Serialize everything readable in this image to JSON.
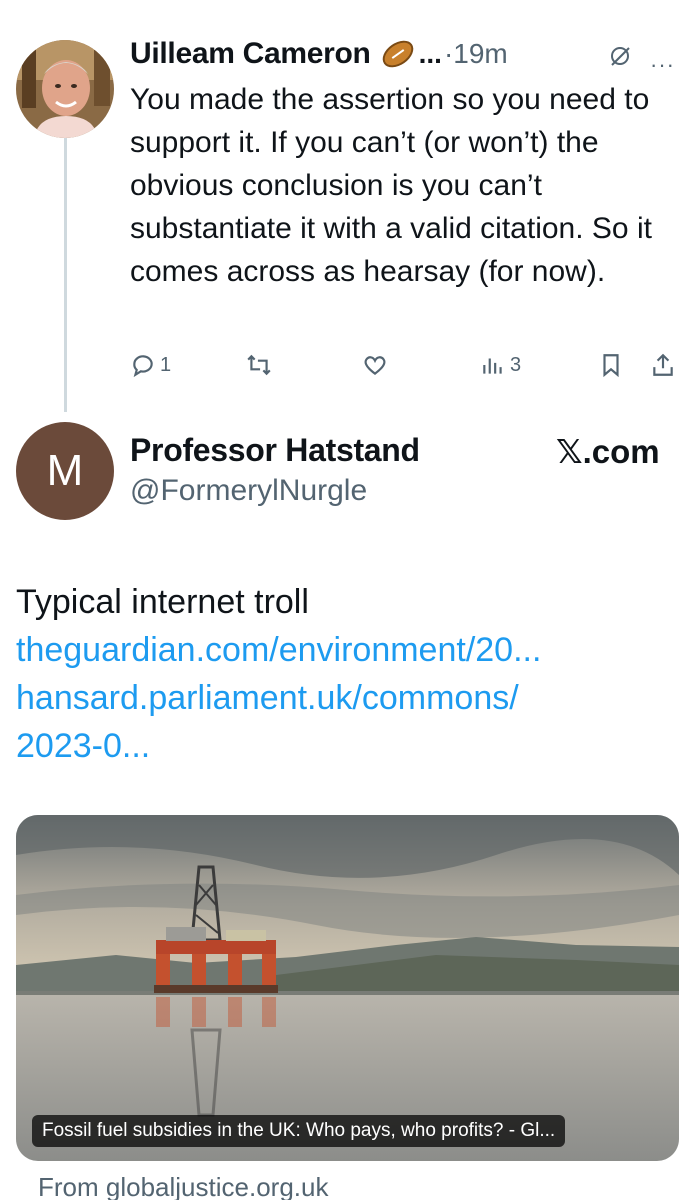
{
  "reply": {
    "author_name": "Uilleam Cameron",
    "ellipsis": "...",
    "separator": "·",
    "time": "19m",
    "more": "···",
    "text": "You made the assertion so you need to support it. If you can’t (or won’t) the obvious conclusion is you can’t substantiate it with a valid citation. So it comes across as hearsay (for now).",
    "actions": {
      "reply_count": "1",
      "retweet_count": "",
      "like_count": "",
      "views_count": "3"
    }
  },
  "quoted": {
    "avatar_letter": "M",
    "author_name": "Professor Hatstand",
    "handle": "@FormerylNurgle",
    "watermark": "𝕏.com",
    "text": "Typical internet troll",
    "links": [
      "theguardian.com/environment/20...",
      "hansard.parliament.uk/commons/",
      "2023-0..."
    ],
    "card": {
      "caption": "Fossil fuel subsidies in the UK: Who pays, who profits? - Gl...",
      "from": "From globaljustice.org.uk"
    }
  },
  "icons": [
    "football-emoji-icon",
    "grok-icon",
    "more-icon",
    "reply-icon",
    "retweet-icon",
    "like-icon",
    "views-icon",
    "bookmark-icon",
    "share-icon"
  ],
  "colors": {
    "link": "#1d9bf0",
    "secondary_text": "#536471",
    "thread_line": "#cfd9de",
    "avatar_bg": "#6b4a3a"
  }
}
